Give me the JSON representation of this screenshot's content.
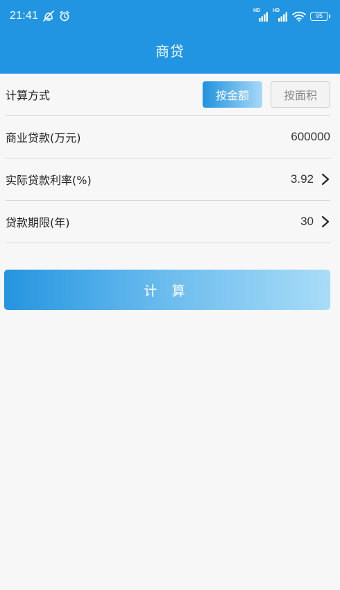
{
  "status_bar": {
    "time": "21:41",
    "battery": "95",
    "icons": [
      "notification-off-icon",
      "alarm-icon",
      "hd-signal-icon",
      "hd-signal-icon",
      "wifi-icon",
      "battery-icon"
    ]
  },
  "header": {
    "title": "商贷"
  },
  "form": {
    "calc_mode": {
      "label": "计算方式",
      "options": [
        "按金额",
        "按面积"
      ],
      "selected": "按金额"
    },
    "loan_amount": {
      "label": "商业贷款(万元)",
      "value": "600000"
    },
    "interest_rate": {
      "label": "实际贷款利率(%)",
      "value": "3.92"
    },
    "loan_term": {
      "label": "贷款期限(年)",
      "value": "30"
    }
  },
  "actions": {
    "calculate_label": "计 算"
  },
  "colors": {
    "primary": "#2195e2",
    "gradient_end": "#a9dcf7",
    "background": "#f7f7f7",
    "divider": "#d9d9d9"
  }
}
